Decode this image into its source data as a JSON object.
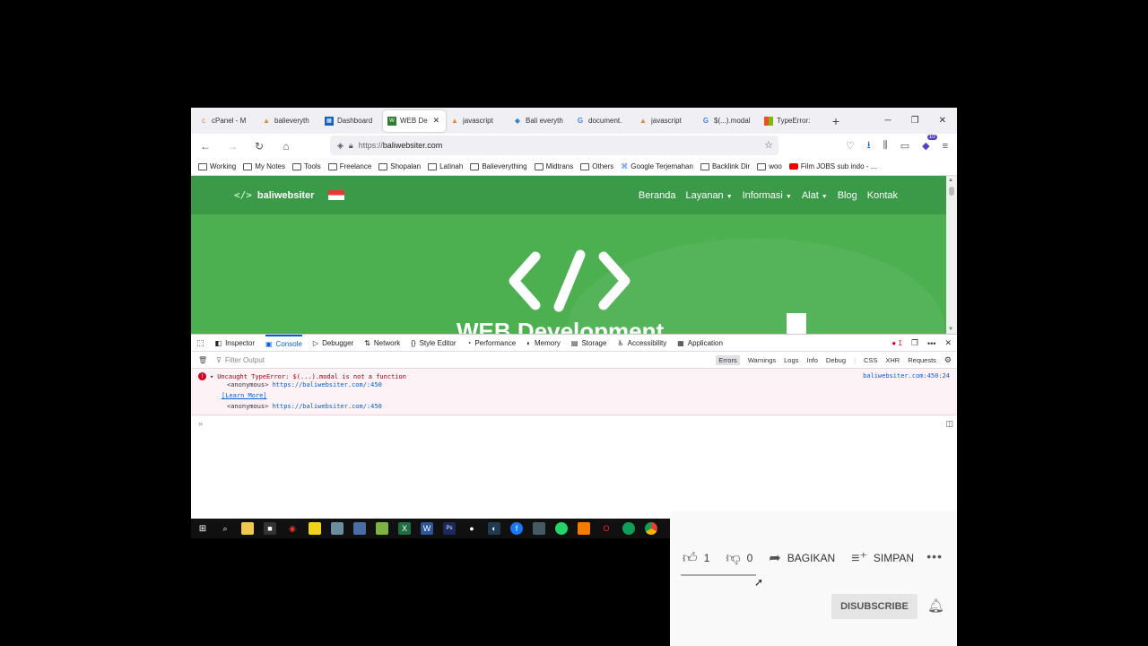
{
  "browser": {
    "tabs": [
      {
        "label": "cPanel - M",
        "icon": "cpanel-icon",
        "color": "#ff6c2c"
      },
      {
        "label": "balieveryth",
        "icon": "mountain-icon",
        "color": "#e08a2a"
      },
      {
        "label": "Dashboard",
        "icon": "dashboard-icon",
        "color": "#1565c0"
      },
      {
        "label": "WEB De",
        "icon": "wb-icon",
        "color": "#2e7d32",
        "active": true
      },
      {
        "label": "javascript",
        "icon": "mountain-icon",
        "color": "#e08a2a"
      },
      {
        "label": "Bali everyth",
        "icon": "bird-icon",
        "color": "#1e88e5"
      },
      {
        "label": "document.",
        "icon": "google-icon",
        "color": "#4285f4"
      },
      {
        "label": "javascript",
        "icon": "mountain-icon",
        "color": "#e08a2a"
      },
      {
        "label": "$(...).modal",
        "icon": "google-icon",
        "color": "#4285f4"
      },
      {
        "label": "TypeError:",
        "icon": "windows-icon",
        "color": "#f25022"
      }
    ],
    "new_tab": "+",
    "url_protocol": "https://",
    "url_host": "baliwebsiter.com",
    "extension_badge": "10",
    "bookmarks": [
      "Working",
      "My Notes",
      "Tools",
      "Freelance",
      "Shopalan",
      "Latinah",
      "Balieverything",
      "Midtrans",
      "Others",
      "Google Terjemahan",
      "Backlink Dir",
      "woo",
      "Film JOBS sub indo - ..."
    ]
  },
  "site": {
    "brand": "baliwebsiter",
    "logo_mark": "</>",
    "menu": [
      {
        "label": "Beranda",
        "dropdown": false
      },
      {
        "label": "Layanan",
        "dropdown": true
      },
      {
        "label": "Informasi",
        "dropdown": true
      },
      {
        "label": "Alat",
        "dropdown": true
      },
      {
        "label": "Blog",
        "dropdown": false
      },
      {
        "label": "Kontak",
        "dropdown": false
      }
    ],
    "hero_title": "WEB Development",
    "colors": {
      "primary": "#4caf50",
      "header": "#3a9a47"
    }
  },
  "devtools": {
    "tabs": [
      "Inspector",
      "Console",
      "Debugger",
      "Network",
      "Style Editor",
      "Performance",
      "Memory",
      "Storage",
      "Accessibility",
      "Application"
    ],
    "active_tab": "Console",
    "error_count": "1",
    "filter_placeholder": "Filter Output",
    "levels": [
      "Errors",
      "Warnings",
      "Logs",
      "Info",
      "Debug"
    ],
    "types": [
      "CSS",
      "XHR",
      "Requests"
    ],
    "error_message": "Uncaught TypeError: $(...).modal is not a function",
    "error_source": "baliwebsiter.com:450:24",
    "stack": [
      {
        "fn": "<anonymous>",
        "url": "https://baliwebsiter.com/:450"
      },
      {
        "fn": "<anonymous>",
        "url": "https://baliwebsiter.com/:450"
      }
    ],
    "learn_more": "[Learn More]",
    "prompt": "»"
  },
  "youtube": {
    "likes": "1",
    "dislikes": "0",
    "share": "BAGIKAN",
    "save": "SIMPAN",
    "more": "•••",
    "subscribe_button": "DISUBSCRIBE"
  }
}
